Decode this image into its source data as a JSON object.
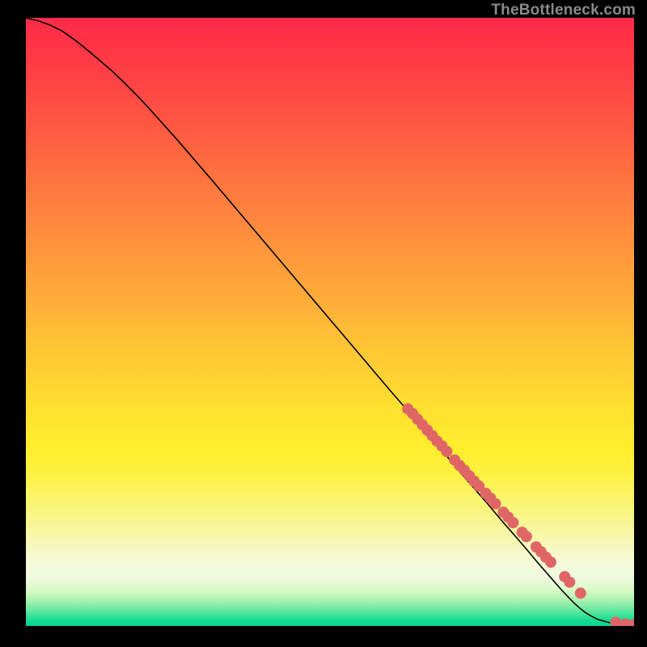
{
  "attribution": "TheBottleneck.com",
  "chart_data": {
    "type": "line",
    "title": "",
    "xlabel": "",
    "ylabel": "",
    "xlim": [
      0,
      100
    ],
    "ylim": [
      0,
      100
    ],
    "grid": false,
    "legend": false,
    "series": [
      {
        "name": "curve",
        "type": "line",
        "color": "#000000",
        "x": [
          0,
          2,
          4,
          6,
          8,
          10,
          12,
          14,
          16,
          18,
          20,
          25,
          30,
          35,
          40,
          45,
          50,
          55,
          60,
          62,
          64,
          66,
          68,
          70,
          72,
          74,
          76,
          78,
          80,
          82,
          84,
          86,
          88,
          90,
          91,
          92,
          93,
          94,
          95,
          96,
          97,
          98,
          99,
          100
        ],
        "y": [
          100,
          99.5,
          98.8,
          97.8,
          96.4,
          94.8,
          93.1,
          91.4,
          89.5,
          87.5,
          85.4,
          79.8,
          74.0,
          68.1,
          62.2,
          56.3,
          50.4,
          44.5,
          38.6,
          36.3,
          34.0,
          31.6,
          29.3,
          27.0,
          24.6,
          22.3,
          20.0,
          17.6,
          15.3,
          13.0,
          10.6,
          8.3,
          6.0,
          3.9,
          3.0,
          2.2,
          1.6,
          1.1,
          0.8,
          0.55,
          0.4,
          0.3,
          0.25,
          0.25
        ]
      },
      {
        "name": "markers",
        "type": "scatter",
        "color": "#e06666",
        "radius": 7,
        "x": [
          62.8,
          63.6,
          64.4,
          65.2,
          66.0,
          66.8,
          67.6,
          68.4,
          69.2,
          70.5,
          71.3,
          72.1,
          72.9,
          73.7,
          74.5,
          75.6,
          76.4,
          77.2,
          78.5,
          79.3,
          80.1,
          81.6,
          82.3,
          83.9,
          84.7,
          85.5,
          86.3,
          88.6,
          89.4,
          91.2,
          97.0,
          98.6,
          100.0
        ],
        "y": [
          35.7,
          34.9,
          34.0,
          33.1,
          32.2,
          31.3,
          30.4,
          29.6,
          28.7,
          27.3,
          26.4,
          25.6,
          24.7,
          23.8,
          23.0,
          21.8,
          21.0,
          20.1,
          18.7,
          17.9,
          17.0,
          15.4,
          14.7,
          13.0,
          12.2,
          11.3,
          10.5,
          8.1,
          7.2,
          5.4,
          0.6,
          0.3,
          0.25
        ]
      }
    ]
  }
}
